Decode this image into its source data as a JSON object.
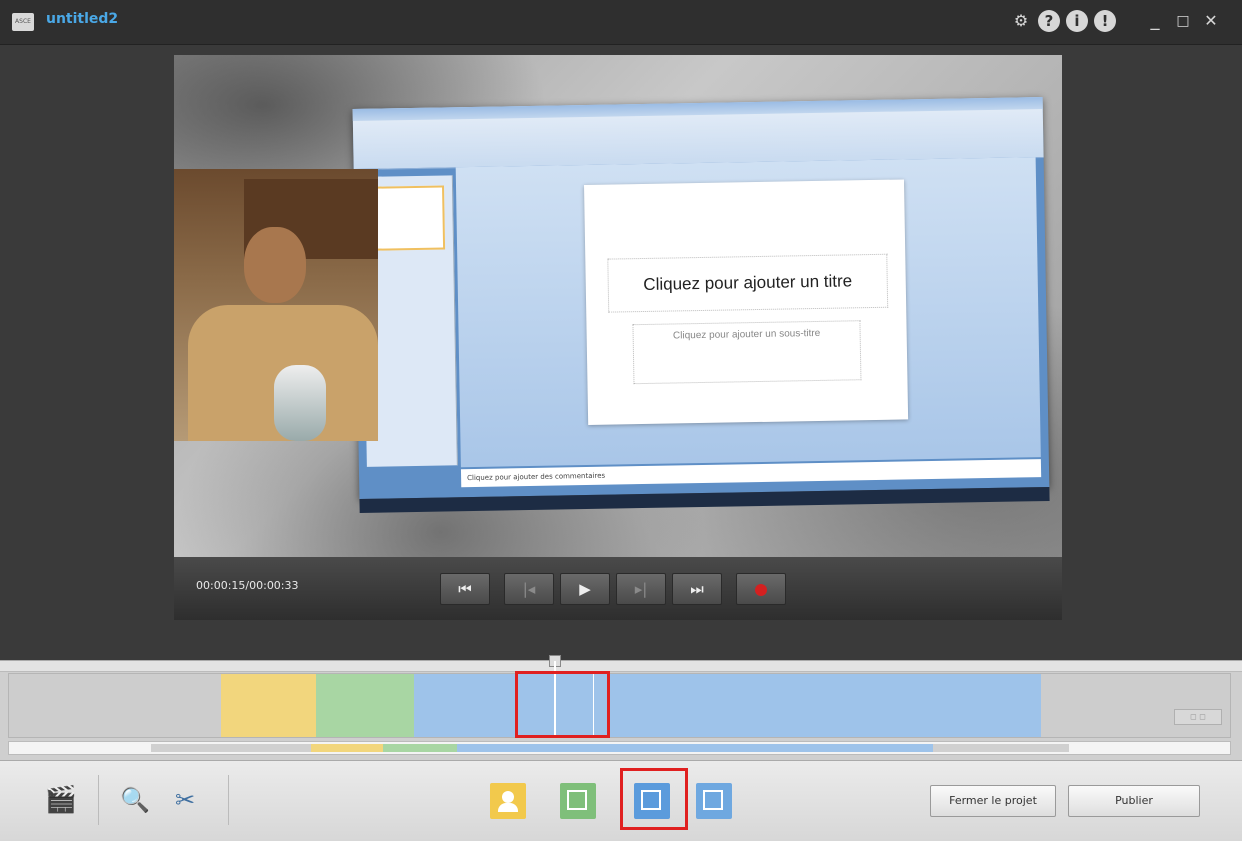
{
  "titlebar": {
    "app_logo_label": "ASCE",
    "title": "untitled2",
    "icons": [
      "gear-icon",
      "help-icon",
      "info-icon",
      "lightbulb-icon"
    ],
    "window_controls": {
      "minimize": "_",
      "maximize": "□",
      "close": "✕"
    }
  },
  "preview": {
    "slide_title": "Cliquez pour ajouter un titre",
    "slide_subtitle": "Cliquez pour ajouter un sous-titre",
    "notes_text": "Cliquez pour ajouter des commentaires"
  },
  "controls": {
    "timecode": "00:00:15/00:00:33",
    "buttons": {
      "to_start": "⏮",
      "prev": "|◂",
      "play": "▶",
      "next": "▸|",
      "to_end": "⏭"
    }
  },
  "timeline": {
    "segments": [
      {
        "name": "webcam",
        "color": "#f2d67d"
      },
      {
        "name": "picture-in-picture-1",
        "color": "#a8d6a3"
      },
      {
        "name": "picture-in-picture-2",
        "color": "#9ec3ea"
      }
    ],
    "zoom_label": "◻ ◻"
  },
  "toolbar": {
    "close_project_label": "Fermer le projet",
    "publish_label": "Publier",
    "colors": {
      "layout_camera": "#f2c94c",
      "layout_screen": "#7fbf7a",
      "layout_pip_left": "#5b9bdc",
      "layout_pip_right": "#6fa8e0"
    }
  }
}
